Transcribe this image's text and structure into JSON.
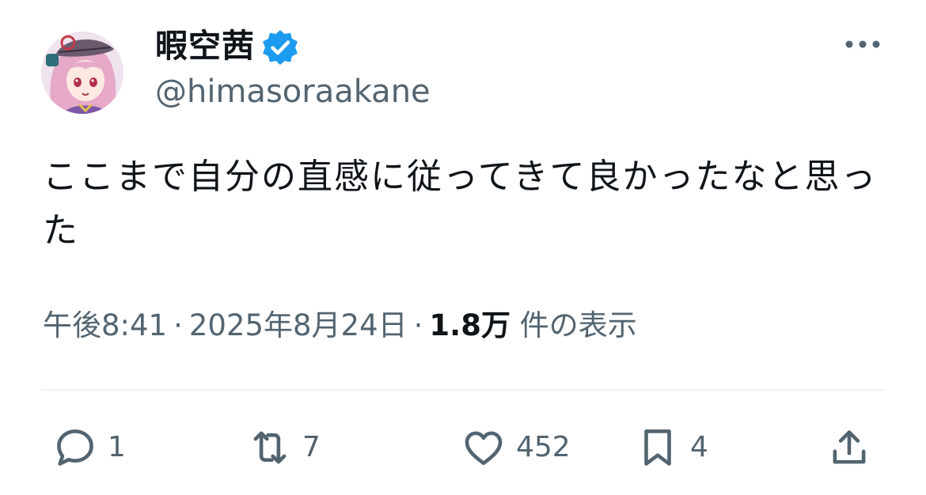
{
  "user": {
    "display_name": "暇空茜",
    "handle": "@himasoraakane",
    "verified": true
  },
  "tweet": {
    "text": "ここまで自分の直感に従ってきて良かったなと思った"
  },
  "meta": {
    "time": "午後8:41",
    "separator": "·",
    "date": "2025年8月24日",
    "views_count": "1.8万",
    "views_label": "件の表示"
  },
  "actions": {
    "replies": "1",
    "retweets": "7",
    "likes": "452",
    "bookmarks": "4"
  },
  "icons": {
    "more": "more-horizontal-icon",
    "reply": "reply-icon",
    "retweet": "retweet-icon",
    "like": "heart-icon",
    "bookmark": "bookmark-icon",
    "share": "share-icon",
    "verified": "verified-badge-icon"
  },
  "colors": {
    "verified_blue": "#1d9bf0",
    "text_primary": "#0f1419",
    "text_secondary": "#536471",
    "divider": "#eff3f4"
  }
}
